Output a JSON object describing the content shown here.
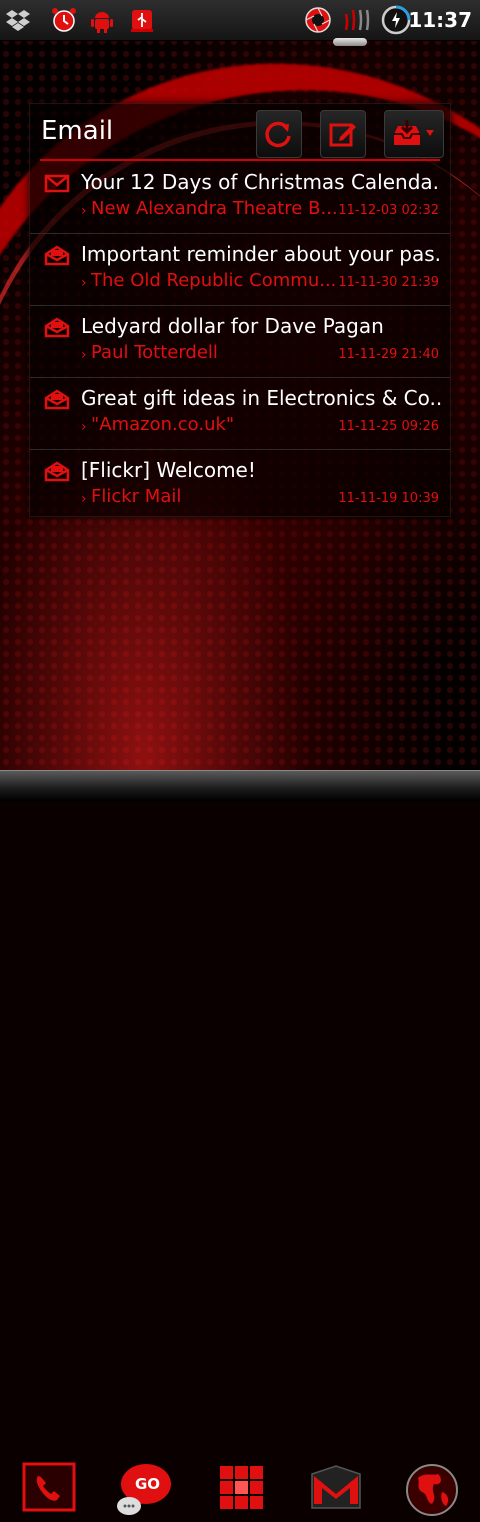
{
  "status_bar": {
    "time": "11:37",
    "icons": [
      "dropbox-icon",
      "alarm-clock-icon",
      "android-icon",
      "usb-icon",
      "camera-shutter-icon",
      "signal-icon",
      "battery-charging-icon"
    ]
  },
  "widget": {
    "title": "Email",
    "buttons": [
      "refresh-icon",
      "compose-icon",
      "inbox-dropdown-icon"
    ],
    "emails": [
      {
        "subject": "Your 12 Days of Christmas Calenda...",
        "sender": "New Alexandra Theatre B...",
        "date": "11-12-03 02:32",
        "unread": true
      },
      {
        "subject": "Important reminder about your pas...",
        "sender": "The Old Republic Commu...",
        "date": "11-11-30 21:39",
        "unread": false
      },
      {
        "subject": "Ledyard dollar for Dave Pagan",
        "sender": "Paul Totterdell",
        "date": "11-11-29 21:40",
        "unread": false
      },
      {
        "subject": "Great gift ideas in Electronics & Co...",
        "sender": "\"Amazon.co.uk\"",
        "date": "11-11-25 09:26",
        "unread": false
      },
      {
        "subject": "[Flickr] Welcome!",
        "sender": "Flickr Mail",
        "date": "11-11-19 10:39",
        "unread": false
      }
    ]
  },
  "dock": {
    "items": [
      "phone-icon",
      "go-sms-icon",
      "app-drawer-icon",
      "gmail-icon",
      "browser-globe-icon"
    ],
    "go_sms_label": "GO"
  },
  "colors": {
    "accent": "#e01010",
    "background": "#0a0000"
  }
}
